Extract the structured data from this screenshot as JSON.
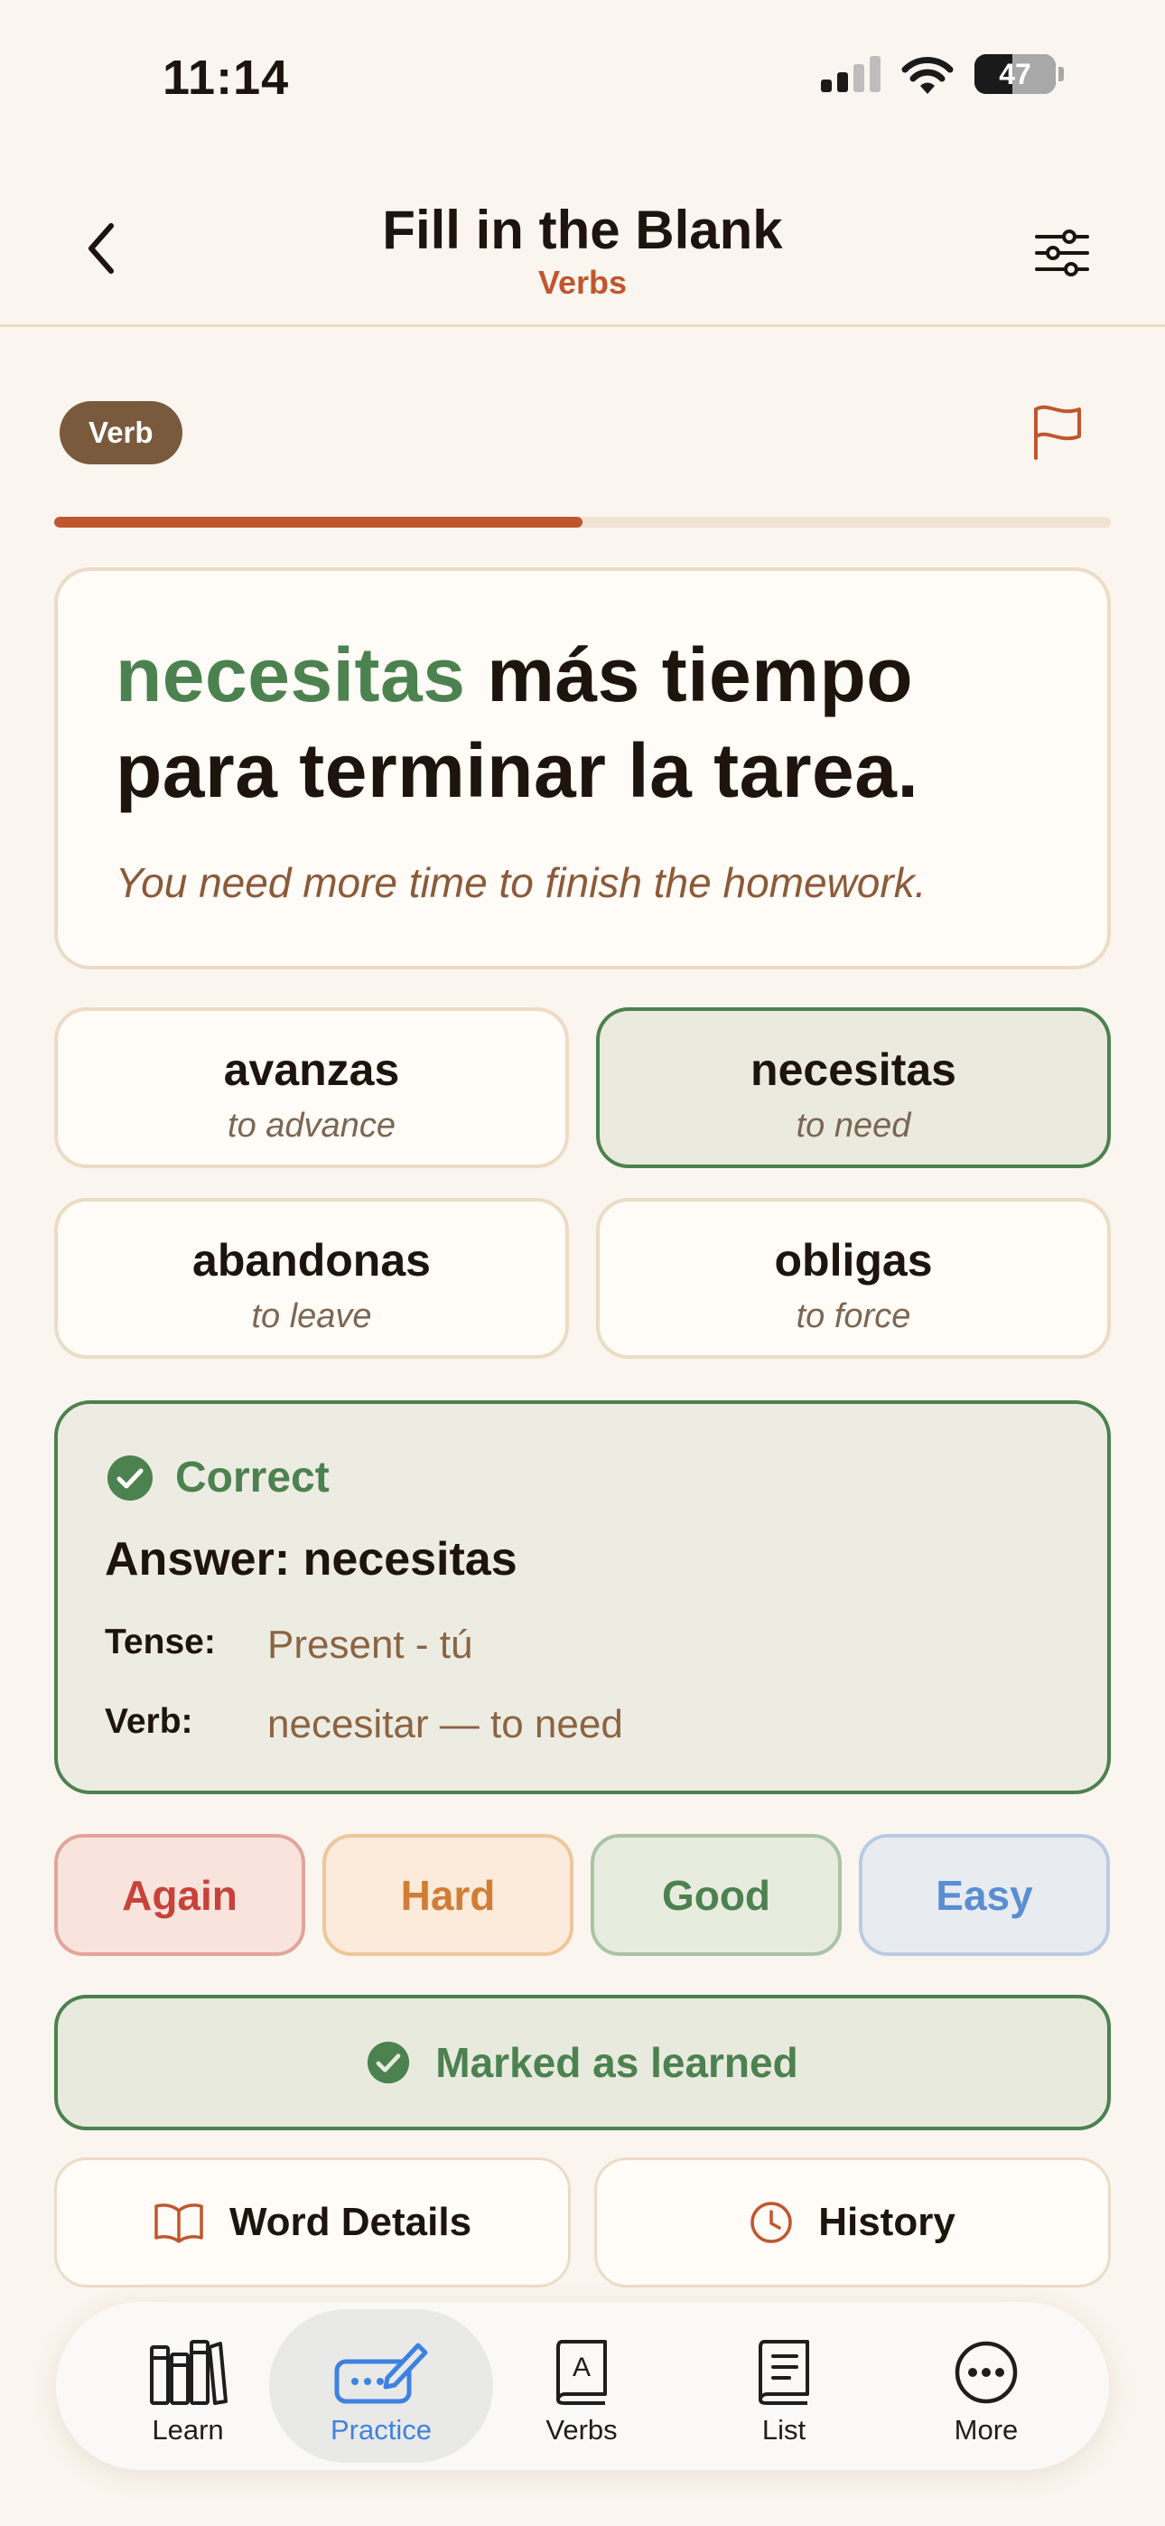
{
  "status_bar": {
    "time": "11:14",
    "battery": "47"
  },
  "header": {
    "title": "Fill in the Blank",
    "subtitle": "Verbs"
  },
  "card": {
    "badge": "Verb",
    "progress": 0.5,
    "answer_word": "necesitas",
    "sentence_rest": " más tiempo para terminar la tarea.",
    "translation": "You need more time to finish the homework."
  },
  "options": [
    {
      "word": "avanzas",
      "gloss": "to advance",
      "state": "default"
    },
    {
      "word": "necesitas",
      "gloss": "to need",
      "state": "correct"
    },
    {
      "word": "abandonas",
      "gloss": "to leave",
      "state": "default"
    },
    {
      "word": "obligas",
      "gloss": "to force",
      "state": "default"
    }
  ],
  "result": {
    "status": "Correct",
    "answer": "Answer: necesitas",
    "tense_label": "Tense:",
    "tense_value": "Present - tú",
    "verb_label": "Verb:",
    "verb_value": "necesitar — to need"
  },
  "rating": {
    "again": "Again",
    "hard": "Hard",
    "good": "Good",
    "easy": "Easy"
  },
  "learned_label": "Marked as learned",
  "actions": {
    "word_details": "Word Details",
    "history": "History"
  },
  "tabs": [
    {
      "label": "Learn",
      "icon": "books-icon"
    },
    {
      "label": "Practice",
      "icon": "pencil-keyboard-icon",
      "active": true
    },
    {
      "label": "Verbs",
      "icon": "book-a-icon"
    },
    {
      "label": "List",
      "icon": "notebook-icon"
    },
    {
      "label": "More",
      "icon": "ellipsis-circle-icon"
    }
  ],
  "colors": {
    "accent": "#C0562E",
    "success": "#4C8150",
    "active_tab": "#3E82E0",
    "background": "#FAF5EE"
  }
}
